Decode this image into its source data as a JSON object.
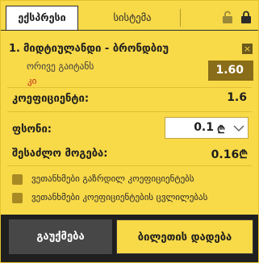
{
  "tabs": {
    "express": "ექსპრესი",
    "system": "სისტემა"
  },
  "icons": {
    "lock_open": "lock-open-icon",
    "lock_closed": "lock-icon",
    "close": "close-icon",
    "chevron": "chevron-down-icon"
  },
  "selection": {
    "number": "1.",
    "match": "მიდტიულანდი - ბრონდბიუ",
    "market": "ორივე გაიტანს",
    "outcome": "კი",
    "odds": "1.60",
    "close_label": "×"
  },
  "summary": {
    "coef_label": "კოეფიციენტი:",
    "coef_value": "1.6",
    "stake_label": "ფსონი:",
    "stake_value": "0.1",
    "currency": "₾",
    "win_label": "შესაძლო მოგება:",
    "win_value": "0.16₾"
  },
  "options": {
    "accept_higher": "ვეთანხმები გაზრდილ კოეფიციენტებს",
    "accept_changes": "ვეთანხმები კოეფიციენტების ცვლილებას"
  },
  "buttons": {
    "cancel": "გაუქმება",
    "place": "ბილეთის დადება"
  },
  "colors": {
    "accent": "#f8d948",
    "odds_box": "#8a6d18",
    "outcome_text": "#c0271b",
    "dark": "#1f1f1f"
  }
}
